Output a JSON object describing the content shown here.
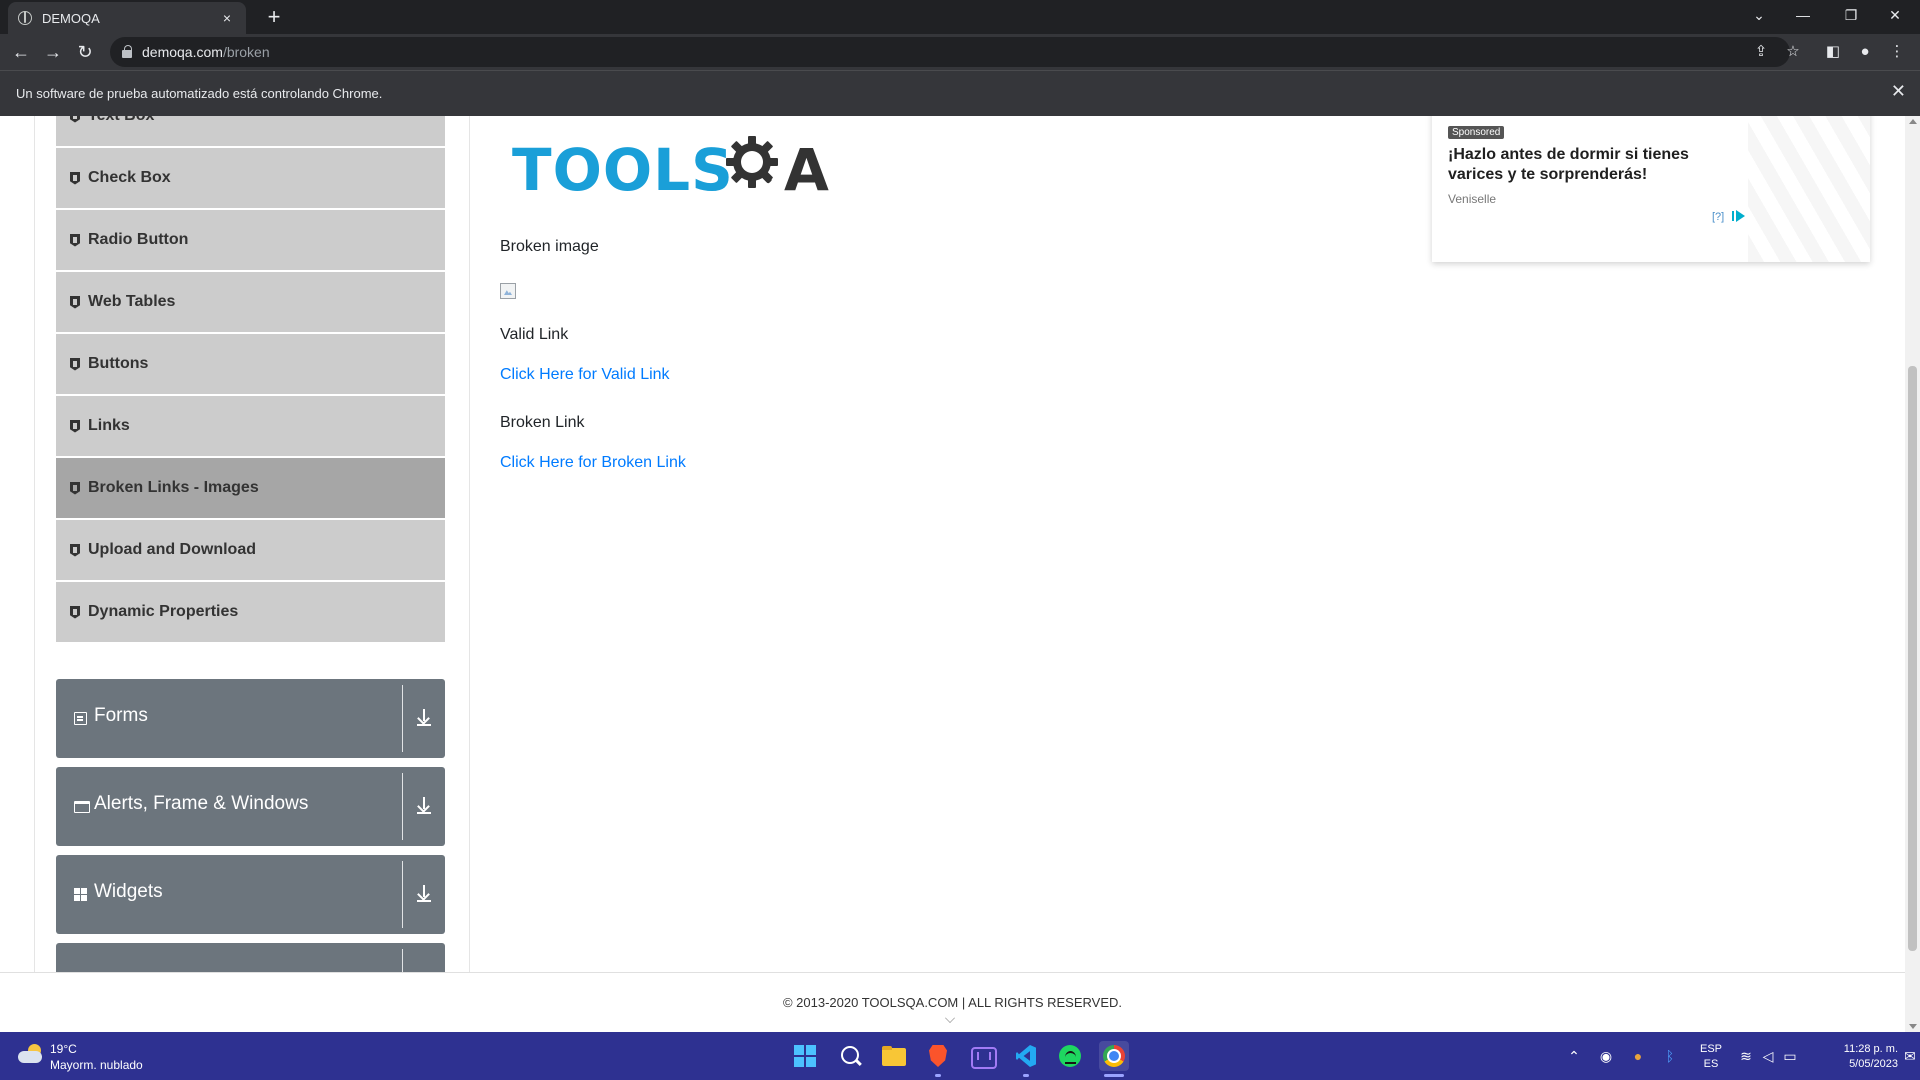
{
  "browser": {
    "tab_title": "DEMOQA",
    "tab_close": "×",
    "new_tab": "+",
    "url_host": "demoqa.com",
    "url_path": "/broken",
    "automation_notice": "Un software de prueba automatizado está controlando Chrome.",
    "notice_close": "✕",
    "icons": [
      "back-arrow-icon",
      "forward-arrow-icon",
      "reload-icon",
      "lock-icon",
      "share-icon",
      "star-icon",
      "side-panel-icon",
      "profile-icon",
      "menu-icon"
    ]
  },
  "sidebar": {
    "items": [
      {
        "label": "Text Box",
        "active": false
      },
      {
        "label": "Check Box",
        "active": false
      },
      {
        "label": "Radio Button",
        "active": false
      },
      {
        "label": "Web Tables",
        "active": false
      },
      {
        "label": "Buttons",
        "active": false
      },
      {
        "label": "Links",
        "active": false
      },
      {
        "label": "Broken Links - Images",
        "active": true
      },
      {
        "label": "Upload and Download",
        "active": false
      },
      {
        "label": "Dynamic Properties",
        "active": false
      }
    ],
    "groups": [
      {
        "label": "Forms",
        "icon": "forms-icon"
      },
      {
        "label": "Alerts, Frame & Windows",
        "icon": "window-icon"
      },
      {
        "label": "Widgets",
        "icon": "widgets-icon"
      },
      {
        "label": "",
        "icon": ""
      }
    ]
  },
  "main": {
    "logo_left": "TOOLS",
    "logo_right": "A",
    "broken_image_label": "Broken image",
    "valid_link_label": "Valid Link",
    "valid_link_text": "Click Here for Valid Link",
    "broken_link_label": "Broken Link",
    "broken_link_text": "Click Here for Broken Link"
  },
  "ad": {
    "badge": "Sponsored",
    "title": "¡Hazlo antes de dormir si tienes varices y te sorprenderás!",
    "source": "Veniselle",
    "info": "[?]"
  },
  "footer": {
    "text": "© 2013-2020 TOOLSQA.COM | ALL RIGHTS RESERVED."
  },
  "taskbar": {
    "weather_temp": "19°C",
    "weather_desc": "Mayorm. nublado",
    "lang_top": "ESP",
    "lang_bottom": "ES",
    "time": "11:28 p. m.",
    "date": "5/05/2023",
    "apps": [
      "windows-start-icon",
      "search-icon",
      "file-explorer-icon",
      "brave-browser-icon",
      "app-icon",
      "vscode-icon",
      "spotify-icon",
      "chrome-icon"
    ]
  },
  "colors": {
    "sidebar_item": "#cccccc",
    "sidebar_active": "#a6a6a6",
    "group_header": "#6c757d",
    "link": "#007bff",
    "taskbar": "#2e3191"
  }
}
